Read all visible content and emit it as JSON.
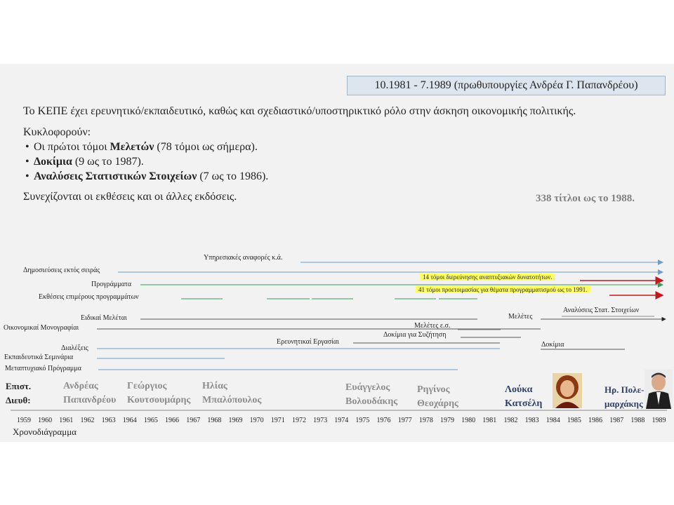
{
  "header": {
    "period": "10.1981 - 7.1989 (πρωθυπουργίες Ανδρέα Γ. Παπανδρέου)"
  },
  "intro": "Το ΚΕΠΕ έχει ερευνητικό/εκπαιδευτικό, καθώς και σχεδιαστικό/υποστηρικτικό ρόλο στην άσκηση οικονομικής πολιτικής.",
  "circulation": {
    "title": "Κυκλοφορούν:",
    "bullets": [
      {
        "bold": "",
        "pre": "Οι πρώτοι τόμοι ",
        "strong": "Μελετών",
        "post": " (78 τόμοι ως σήμερα)."
      },
      {
        "pre": "",
        "strong": "Δοκίμια",
        "post": " (9 ως το 1987)."
      },
      {
        "pre": "",
        "strong": "Αναλύσεις Στατιστικών Στοιχείων",
        "post": " (7 ως το 1986)."
      }
    ],
    "continue": "Συνεχίζονται οι εκθέσεις και οι άλλες εκδόσεις.",
    "total": "338 τίτλοι ως το 1988."
  },
  "series_labels": {
    "reports": "Υπηρεσιακές αναφορές κ.ά.",
    "publications": "Δημοσιεύσεις εκτός σειράς",
    "programmes": "Προγράμματα",
    "programme_reports": "Εκθέσεις επιμέρους προγραμμάτων",
    "special": "Ειδικαί Μελέται",
    "monographs": "Οικονομικαί Μονογραφίαι",
    "lectures": "Διαλέξεις",
    "seminars": "Εκπαιδευτικά Σεμινάρια",
    "postgrad": "Μεταπτυχιακό Πρόγραμμα",
    "studies_es": "Μελέτες ε.σ.",
    "essays_disc": "Δοκίμια για Συζήτηση",
    "research": "Ερευνητικαί Εργασίαι",
    "studies": "Μελέτες",
    "stat_analyses": "Αναλύσεις Στατ. Στοιχείων",
    "essays": "Δοκίμια"
  },
  "notes": {
    "volumes_14": "14 τόμοι διερεύνησης αναπτυξιακών δυνατοτήτων.",
    "volumes_41": "41 τόμοι προετοιμασίας για θέματα προγραμματισμού ως το 1991."
  },
  "directors": {
    "label_line1": "Επιστ.",
    "label_line2": "Διευθ:",
    "names": [
      {
        "first": "Ανδρέας",
        "last": "Παπανδρέου"
      },
      {
        "first": "Γεώργιος",
        "last": "Κουτσουμάρης"
      },
      {
        "first": "Ηλίας",
        "last": "Μπαλόπουλος"
      },
      {
        "first": "Ευάγγελος",
        "last": "Βολουδάκης"
      },
      {
        "first": "Ρηγίνος",
        "last": "Θεοχάρης"
      },
      {
        "first": "Λούκα",
        "last": "Κατσέλη"
      },
      {
        "first": "Ηρ. Πολε-",
        "last": "μαρχάκης"
      }
    ]
  },
  "years": [
    "1959",
    "1960",
    "1961",
    "1962",
    "1963",
    "1964",
    "1965",
    "1966",
    "1967",
    "1968",
    "1969",
    "1970",
    "1971",
    "1972",
    "1973",
    "1974",
    "1975",
    "1976",
    "1977",
    "1978",
    "1979",
    "1980",
    "1981",
    "1982",
    "1983",
    "1984",
    "1985",
    "1986",
    "1987",
    "1988",
    "1989"
  ],
  "timeline_label": "Χρονοδιάγραμμα",
  "colors": {
    "blue": "#6c9fc8",
    "green": "#3a9a5a",
    "red": "#c0181d",
    "dark": "#222222",
    "grey_text": "#8c8c8c",
    "highlight": "#ffff66",
    "katseli_blue": "#2e3f66"
  }
}
